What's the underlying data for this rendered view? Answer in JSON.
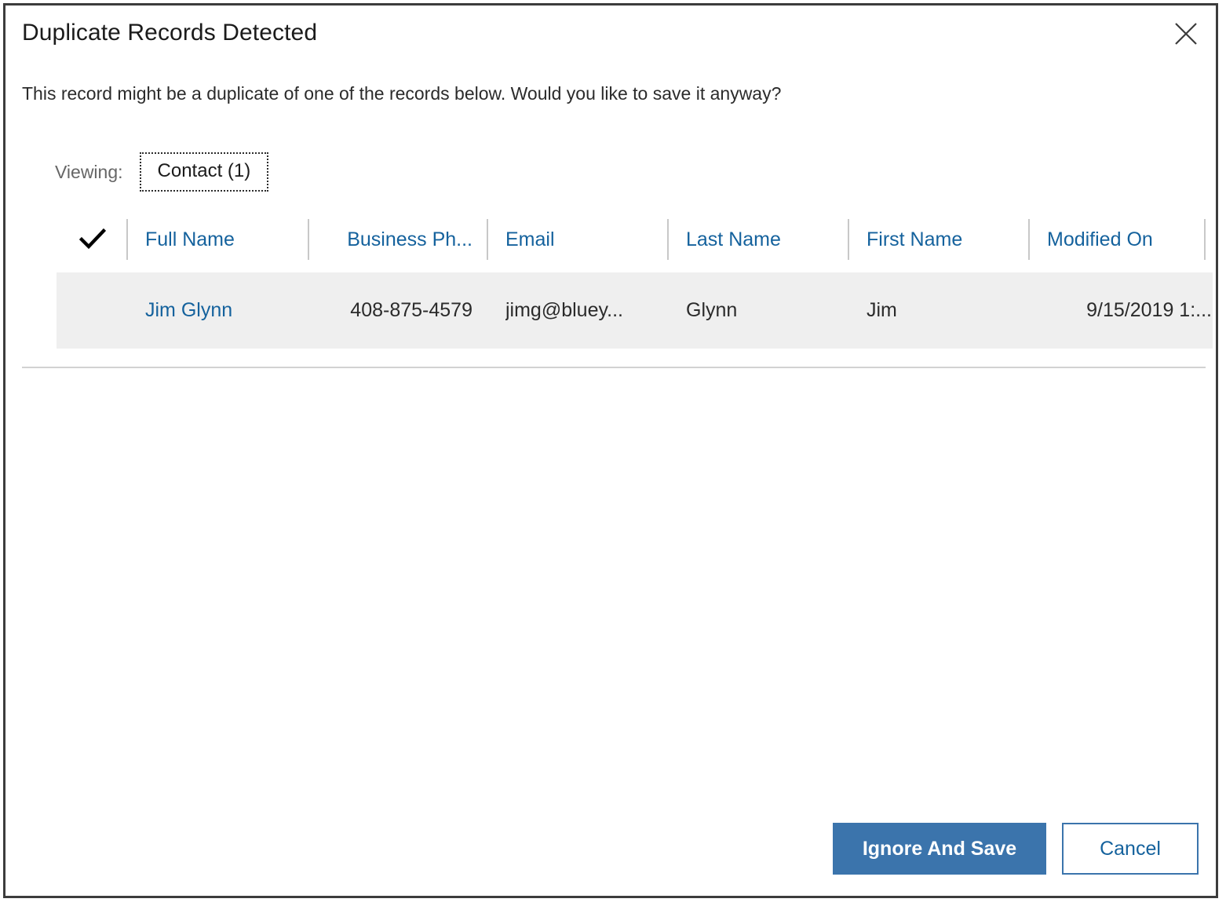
{
  "dialog": {
    "title": "Duplicate Records Detected",
    "subtitle": "This record might be a duplicate of one of the records below. Would you like to save it anyway?",
    "close_icon": "close-icon"
  },
  "viewing": {
    "label": "Viewing:",
    "tab_label": "Contact (1)"
  },
  "grid": {
    "select_all_icon": "checkmark-icon",
    "columns": [
      {
        "key": "full_name",
        "label": "Full Name",
        "align": "left"
      },
      {
        "key": "business_phone",
        "label": "Business Ph...",
        "align": "right"
      },
      {
        "key": "email",
        "label": "Email",
        "align": "left"
      },
      {
        "key": "last_name",
        "label": "Last Name",
        "align": "left"
      },
      {
        "key": "first_name",
        "label": "First Name",
        "align": "left"
      },
      {
        "key": "modified_on",
        "label": "Modified On",
        "align": "right"
      }
    ],
    "rows": [
      {
        "full_name": "Jim Glynn",
        "business_phone": "408-875-4579",
        "email": "jimg@bluey...",
        "last_name": "Glynn",
        "first_name": "Jim",
        "modified_on": "9/15/2019 1:..."
      }
    ]
  },
  "footer": {
    "primary_label": "Ignore And Save",
    "secondary_label": "Cancel"
  },
  "colors": {
    "accent_blue": "#15629d",
    "primary_button": "#3b74ac",
    "row_highlight": "#efefef",
    "border": "#3c3c3c",
    "muted_text": "#666666"
  }
}
